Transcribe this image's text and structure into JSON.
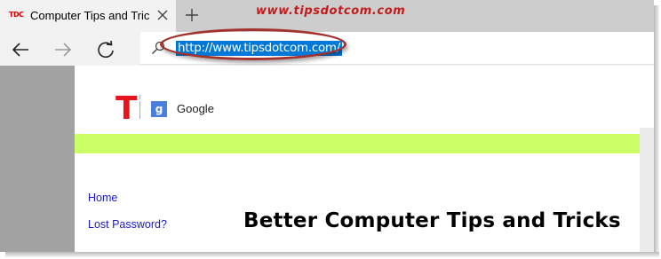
{
  "tab": {
    "favicon_text": "TDC",
    "title": "Computer Tips and Tricks"
  },
  "overlay": {
    "site_watermark": "www.tipsdotcom.com"
  },
  "toolbar": {
    "back_icon": "arrow-left-icon",
    "forward_icon": "arrow-right-icon",
    "refresh_icon": "refresh-icon"
  },
  "address_bar": {
    "url": "http://www.tipsdotcom.com/",
    "icon": "search-icon"
  },
  "suggestions": [
    {
      "label": "Google",
      "icon": "google-icon",
      "icon_letter": "g"
    }
  ],
  "page": {
    "logo_partial": "Ti",
    "nav_links": [
      "Home",
      "Lost Password?"
    ],
    "heading": "Better Computer Tips and Tricks"
  },
  "colors": {
    "accent_selection": "#0078d7",
    "annotation_red": "#a3322d",
    "green_band": "#ccff66",
    "logo_red": "#e8141c",
    "link_blue": "#1a1acc"
  }
}
